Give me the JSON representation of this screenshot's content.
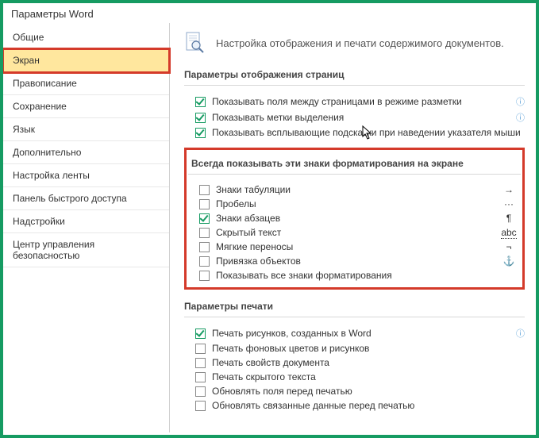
{
  "window": {
    "title": "Параметры Word"
  },
  "sidebar": {
    "items": [
      {
        "label": "Общие"
      },
      {
        "label": "Экран",
        "selected": true
      },
      {
        "label": "Правописание"
      },
      {
        "label": "Сохранение"
      },
      {
        "label": "Язык"
      },
      {
        "label": "Дополнительно"
      },
      {
        "label": "Настройка ленты"
      },
      {
        "label": "Панель быстрого доступа"
      },
      {
        "label": "Надстройки"
      },
      {
        "label": "Центр управления безопасностью"
      }
    ]
  },
  "content": {
    "header": "Настройка отображения и печати содержимого документов.",
    "section1": {
      "title": "Параметры отображения страниц",
      "opts": [
        {
          "label": "Показывать поля между страницами в режиме разметки",
          "checked": true,
          "info": true
        },
        {
          "label": "Показывать метки выделения",
          "checked": true,
          "info": true
        },
        {
          "label": "Показывать всплывающие подсказки при наведении указателя мыши",
          "checked": true
        }
      ]
    },
    "section2": {
      "title": "Всегда показывать эти знаки форматирования на экране",
      "opts": [
        {
          "label": "Знаки табуляции",
          "checked": false,
          "sym": "→"
        },
        {
          "label": "Пробелы",
          "checked": false,
          "sym": "···"
        },
        {
          "label": "Знаки абзацев",
          "checked": true,
          "sym": "¶"
        },
        {
          "label": "Скрытый текст",
          "checked": false,
          "sym": "abc"
        },
        {
          "label": "Мягкие переносы",
          "checked": false,
          "sym": "¬"
        },
        {
          "label": "Привязка объектов",
          "checked": false,
          "sym": "⚓"
        },
        {
          "label": "Показывать все знаки форматирования",
          "checked": false
        }
      ]
    },
    "section3": {
      "title": "Параметры печати",
      "opts": [
        {
          "label": "Печать рисунков, созданных в Word",
          "checked": true,
          "info": true
        },
        {
          "label": "Печать фоновых цветов и рисунков",
          "checked": false
        },
        {
          "label": "Печать свойств документа",
          "checked": false
        },
        {
          "label": "Печать скрытого текста",
          "checked": false
        },
        {
          "label": "Обновлять поля перед печатью",
          "checked": false
        },
        {
          "label": "Обновлять связанные данные перед печатью",
          "checked": false
        }
      ]
    }
  }
}
